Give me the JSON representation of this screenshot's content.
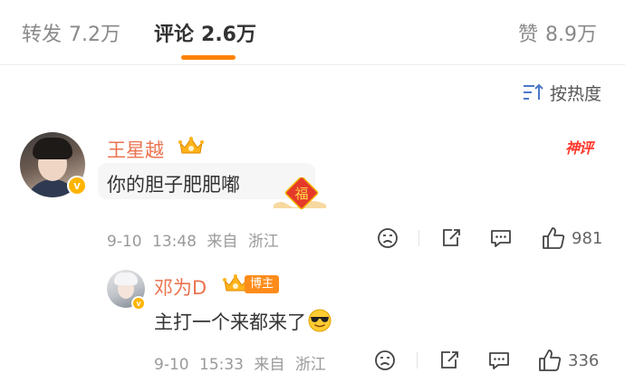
{
  "tabs": [
    {
      "label": "转发",
      "count": "7.2万",
      "active": false
    },
    {
      "label": "评论",
      "count": "2.6万",
      "active": true
    },
    {
      "label": "赞",
      "count": "8.9万",
      "active": false
    }
  ],
  "sort": {
    "label": "按热度",
    "icon": "sort-icon"
  },
  "accent_color": "#ff8200",
  "username_color": "#eb7350",
  "comment": {
    "author": "王星越",
    "badge_icon": "vip-crown-icon",
    "god_comment_tag": "神评",
    "text": "你的胆子肥肥嘟",
    "sticker": "福",
    "date": "9-10",
    "time": "13:48",
    "location_prefix": "来自",
    "location": "浙江",
    "likes": "981"
  },
  "reply": {
    "author": "邓为D",
    "badge_icon": "vip-crown-icon",
    "host_label": "博主",
    "text": "主打一个来都来了",
    "emoji": "cool-sunglasses-emoji",
    "date": "9-10",
    "time": "15:33",
    "location_prefix": "来自",
    "location": "浙江",
    "likes": "336"
  }
}
